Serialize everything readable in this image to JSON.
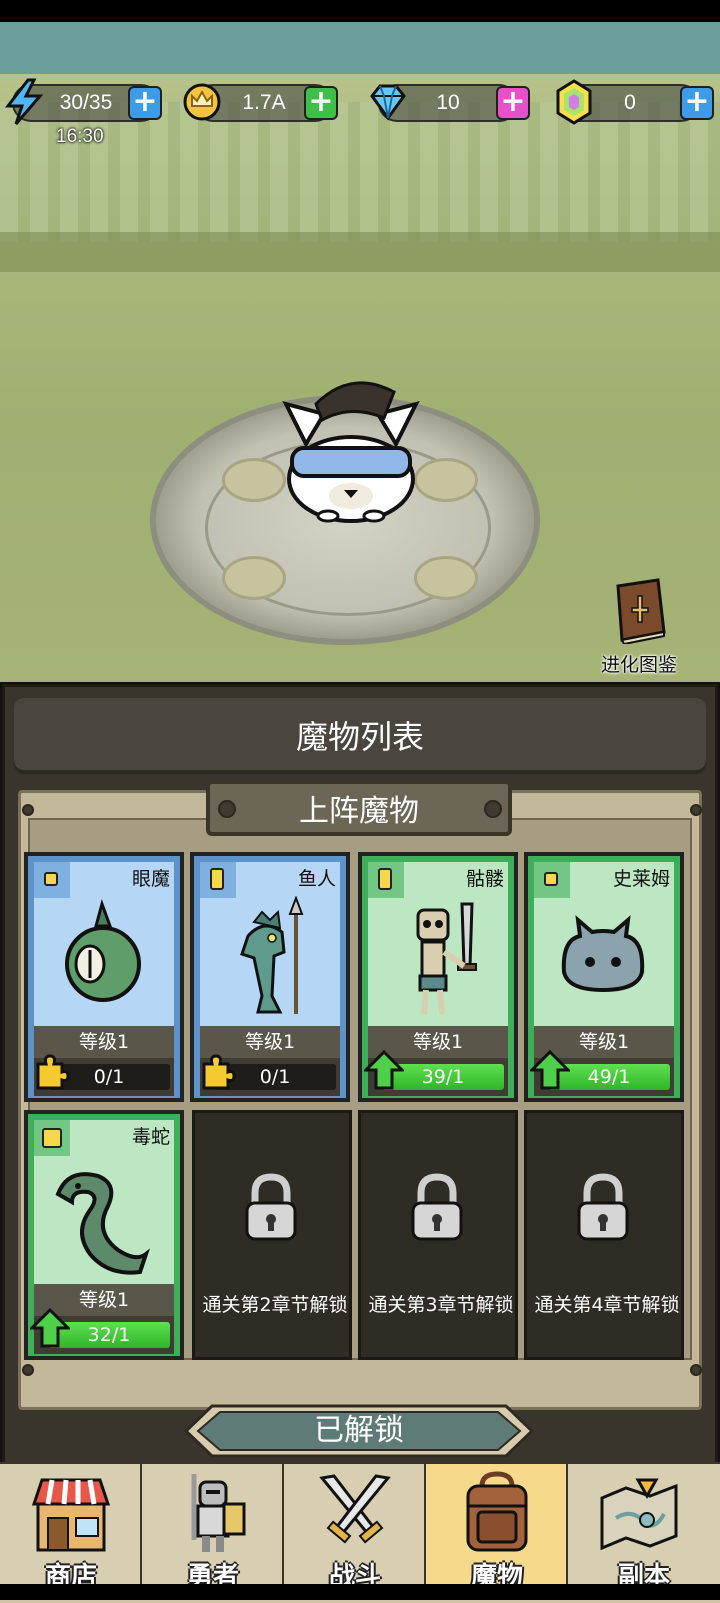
{
  "resources": {
    "energy": {
      "value": "30/35",
      "timer": "16:30",
      "icon": "lightning-icon"
    },
    "gold": {
      "value": "1.7A",
      "icon": "crown-coin-icon"
    },
    "diamond": {
      "value": "10",
      "icon": "diamond-icon"
    },
    "crystal": {
      "value": "0",
      "icon": "rainbow-crystal-icon"
    }
  },
  "evolution_book": {
    "label": "进化图鉴",
    "icon": "book-icon"
  },
  "panel": {
    "title": "魔物列表",
    "subtitle": "上阵魔物",
    "unlocked_button": "已解锁"
  },
  "monsters": [
    {
      "name": "眼魔",
      "level": "等级1",
      "progress": "0/1",
      "fill": 0.0,
      "rarity": "blue",
      "icon": "puzzle-piece-icon"
    },
    {
      "name": "鱼人",
      "level": "等级1",
      "progress": "0/1",
      "fill": 0.0,
      "rarity": "blue",
      "icon": "puzzle-piece-icon"
    },
    {
      "name": "骷髅",
      "level": "等级1",
      "progress": "39/1",
      "fill": 1.0,
      "rarity": "green",
      "icon": "up-arrow-icon"
    },
    {
      "name": "史莱姆",
      "level": "等级1",
      "progress": "49/1",
      "fill": 1.0,
      "rarity": "green",
      "icon": "up-arrow-icon"
    },
    {
      "name": "毒蛇",
      "level": "等级1",
      "progress": "32/1",
      "fill": 1.0,
      "rarity": "green",
      "icon": "up-arrow-icon"
    }
  ],
  "locked": [
    {
      "text": "通关第2章节解锁",
      "icon": "padlock-icon"
    },
    {
      "text": "通关第3章节解锁",
      "icon": "padlock-icon"
    },
    {
      "text": "通关第4章节解锁",
      "icon": "padlock-icon"
    }
  ],
  "nav": [
    {
      "label": "商店",
      "icon": "shop-icon"
    },
    {
      "label": "勇者",
      "icon": "knight-icon"
    },
    {
      "label": "战斗",
      "icon": "crossed-swords-icon"
    },
    {
      "label": "魔物",
      "icon": "backpack-icon",
      "active": true
    },
    {
      "label": "副本",
      "icon": "map-icon"
    }
  ]
}
